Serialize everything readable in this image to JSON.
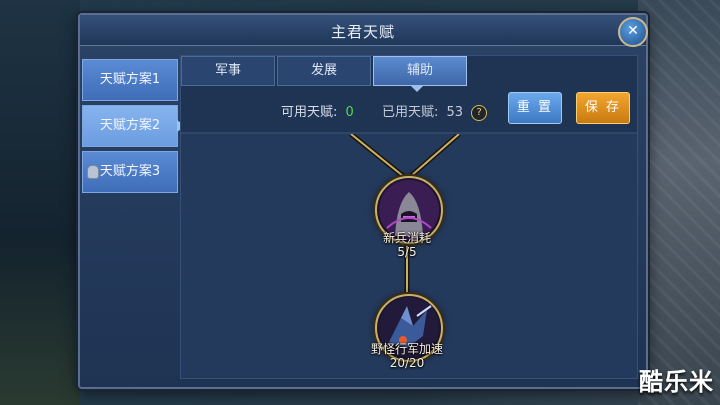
{
  "window": {
    "title": "主君天赋",
    "close_icon": "close-icon"
  },
  "sidebar": {
    "items": [
      {
        "label": "天赋方案1",
        "active": false,
        "locked": false
      },
      {
        "label": "天赋方案2",
        "active": true,
        "locked": false
      },
      {
        "label": "天赋方案3",
        "active": false,
        "locked": true
      }
    ]
  },
  "tabs": [
    {
      "label": "军事",
      "active": false
    },
    {
      "label": "发展",
      "active": false
    },
    {
      "label": "辅助",
      "active": true
    }
  ],
  "talents": {
    "available_label": "可用天赋:",
    "available_value": "0",
    "used_label": "已用天赋:",
    "used_value": "53",
    "help_icon": "help-icon"
  },
  "buttons": {
    "reset": "重 置",
    "save": "保 存"
  },
  "nodes": [
    {
      "name": "新兵消耗",
      "progress": "5/5",
      "icon": "hooded-knight-icon"
    },
    {
      "name": "野怪行军加速",
      "progress": "20/20",
      "icon": "monster-rider-icon"
    }
  ],
  "watermark": "酷乐米",
  "colors": {
    "available_green": "#4fdc4a",
    "save_orange": "#e0961e",
    "reset_blue": "#4f8ed8"
  }
}
